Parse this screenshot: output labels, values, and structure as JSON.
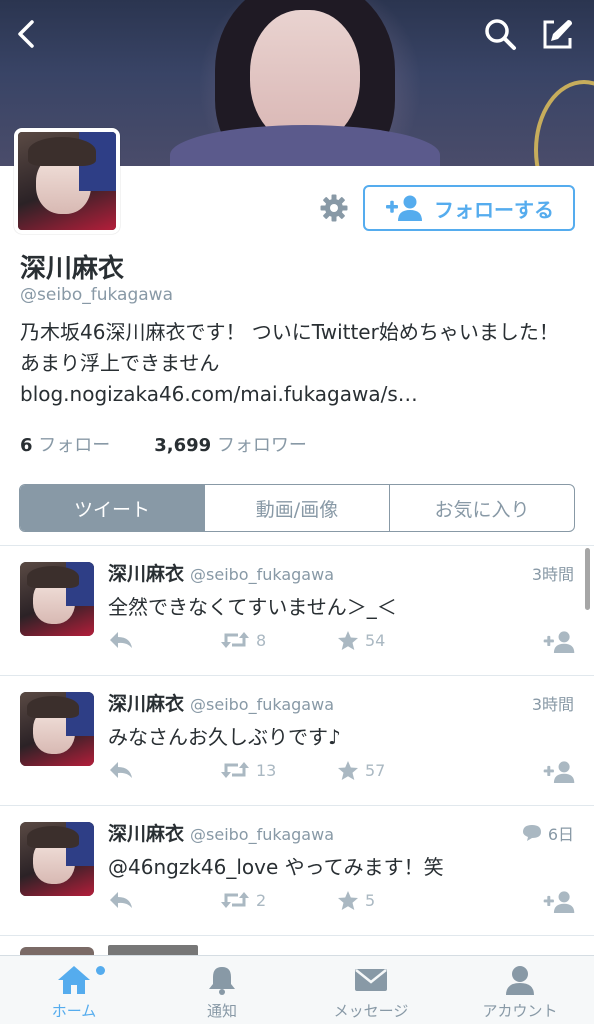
{
  "profile": {
    "name": "深川麻衣",
    "handle": "@seibo_fukagawa",
    "bio": "乃木坂46深川麻衣です！ ついにTwitter始めちゃいました！ あまり浮上できませんblog.nogizaka46.com/mai.fukagawa/s…",
    "following_count": "6",
    "following_label": "フォロー",
    "followers_count": "3,699",
    "followers_label": "フォロワー",
    "follow_button_label": "フォローする"
  },
  "segments": [
    "ツイート",
    "動画/画像",
    "お気に入り"
  ],
  "tweets": [
    {
      "name": "深川麻衣",
      "handle": "@seibo_fukagawa",
      "time": "3時間",
      "text": "全然できなくてすいません＞_＜",
      "retweets": "8",
      "favorites": "54",
      "has_reply_icon": false
    },
    {
      "name": "深川麻衣",
      "handle": "@seibo_fukagawa",
      "time": "3時間",
      "text": "みなさんお久しぶりです♪",
      "retweets": "13",
      "favorites": "57",
      "has_reply_icon": false
    },
    {
      "name": "深川麻衣",
      "handle": "@seibo_fukagawa",
      "time": "6日",
      "text": "@46ngzk46_love やってみます！笑",
      "retweets": "2",
      "favorites": "5",
      "has_reply_icon": true
    }
  ],
  "tabbar": {
    "home": "ホーム",
    "notifications": "通知",
    "messages": "メッセージ",
    "account": "アカウント"
  },
  "colors": {
    "accent": "#55acee",
    "muted": "#8899a6",
    "text": "#292f33"
  }
}
